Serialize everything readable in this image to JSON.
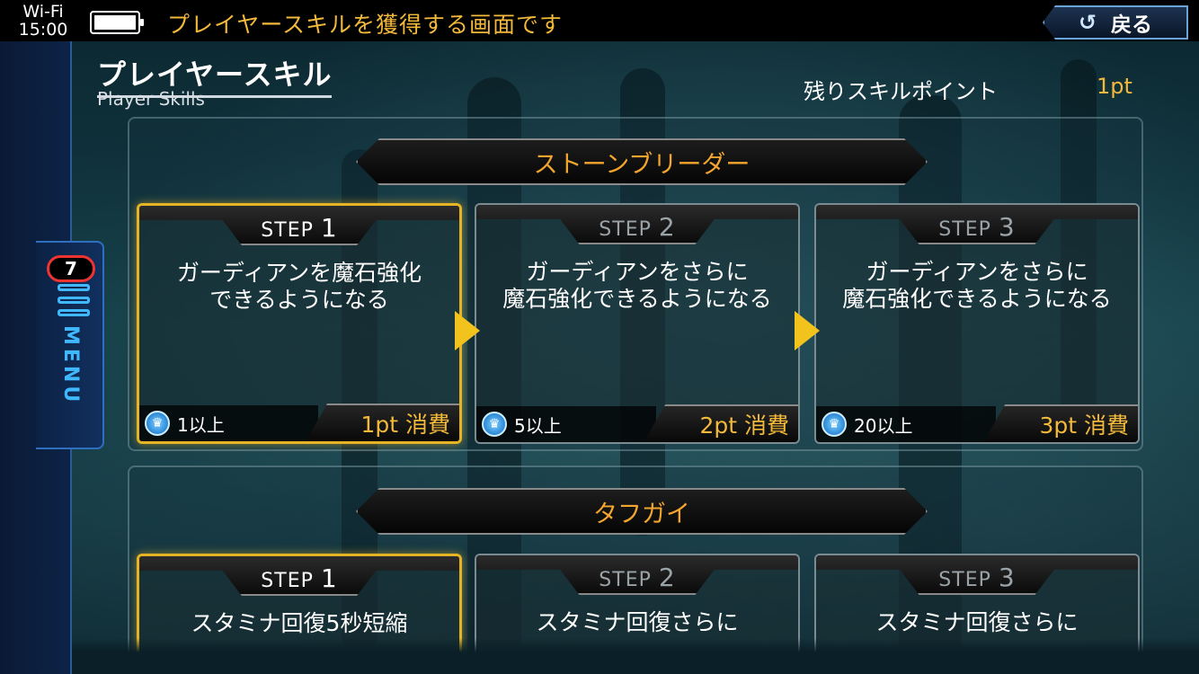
{
  "status": {
    "network": "Wi-Fi",
    "time": "15:00"
  },
  "topbar": {
    "description": "プレイヤースキルを獲得する画面です",
    "back_label": "戻る"
  },
  "menu": {
    "badge_count": "7",
    "label": "MENU"
  },
  "header": {
    "title": "プレイヤースキル",
    "subtitle": "Player Skills",
    "points_label": "残りスキルポイント",
    "points_value": "1pt"
  },
  "skills": [
    {
      "name": "ストーンブリーダー",
      "steps": [
        {
          "step_label": "STEP",
          "step_num": "1",
          "description": "ガーディアンを魔石強化\nできるようになる",
          "requirement": "1以上",
          "cost": "1pt  消費",
          "active": true
        },
        {
          "step_label": "STEP",
          "step_num": "2",
          "description": "ガーディアンをさらに\n魔石強化できるようになる",
          "requirement": "5以上",
          "cost": "2pt  消費",
          "active": false
        },
        {
          "step_label": "STEP",
          "step_num": "3",
          "description": "ガーディアンをさらに\n魔石強化できるようになる",
          "requirement": "20以上",
          "cost": "3pt  消費",
          "active": false
        }
      ]
    },
    {
      "name": "タフガイ",
      "steps": [
        {
          "step_label": "STEP",
          "step_num": "1",
          "description": "スタミナ回復5秒短縮",
          "active": true
        },
        {
          "step_label": "STEP",
          "step_num": "2",
          "description": "スタミナ回復さらに",
          "active": false
        },
        {
          "step_label": "STEP",
          "step_num": "3",
          "description": "スタミナ回復さらに",
          "active": false
        }
      ]
    }
  ],
  "colors": {
    "accent": "#f3b93b",
    "banner_text": "#f3a52d",
    "active_border": "#e4b326",
    "menu_blue": "#3fb8ff",
    "badge_red": "#ee3333"
  },
  "icons": {
    "back": "return-arrow-icon",
    "menu": "menu-lines-icon",
    "crown": "crown-icon",
    "next": "triangle-right-icon"
  }
}
